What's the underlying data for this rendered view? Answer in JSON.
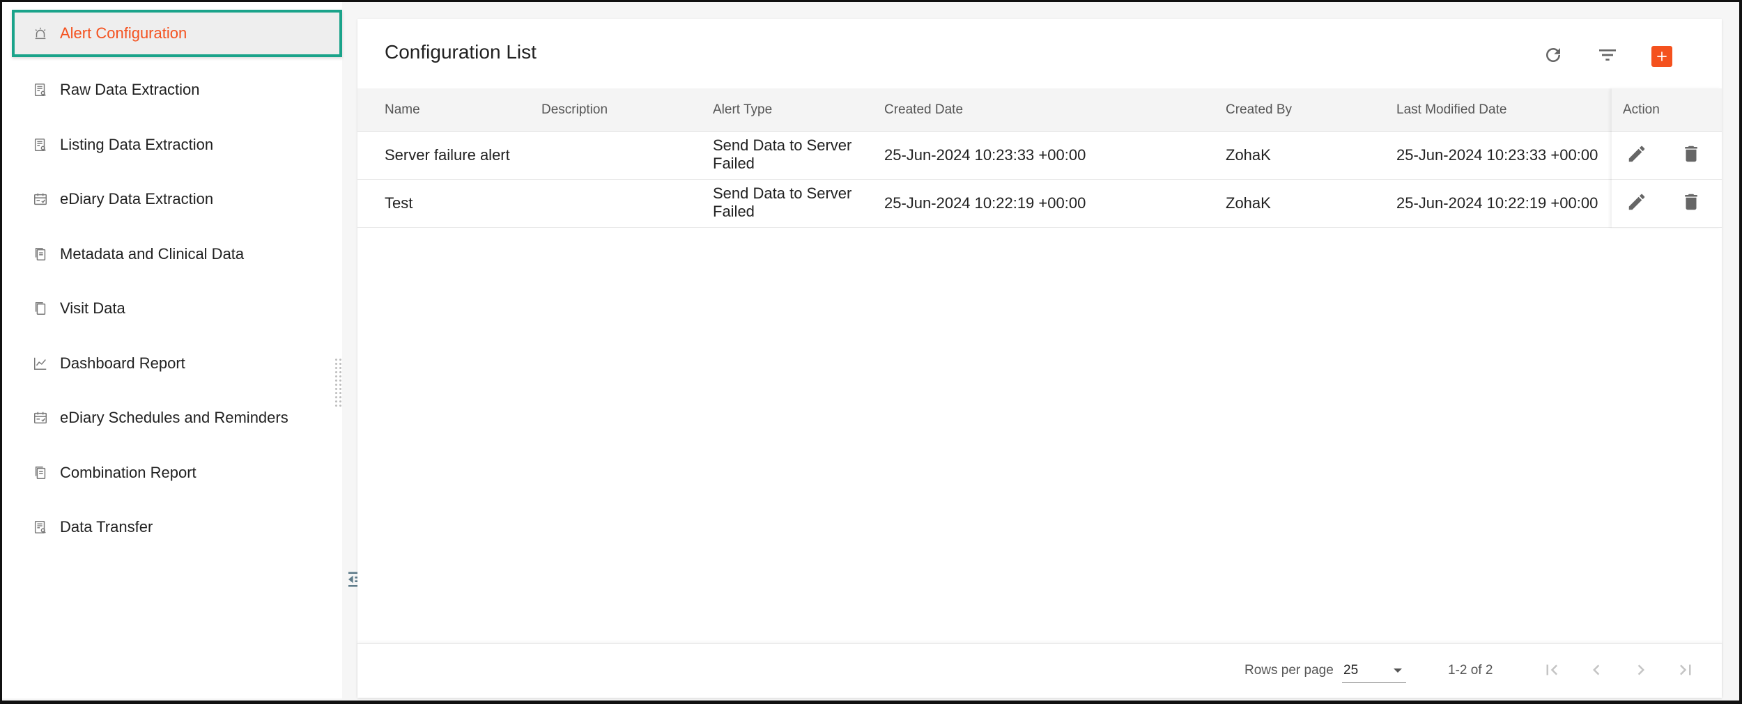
{
  "sidebar": {
    "items": [
      {
        "label": "Alert Configuration",
        "icon": "alarm-icon"
      },
      {
        "label": "Raw Data Extraction",
        "icon": "report-search-icon"
      },
      {
        "label": "Listing Data Extraction",
        "icon": "report-search-icon"
      },
      {
        "label": "eDiary Data Extraction",
        "icon": "calendar-check-icon"
      },
      {
        "label": "Metadata and Clinical Data",
        "icon": "copy-documents-icon"
      },
      {
        "label": "Visit Data",
        "icon": "copy-documents-icon"
      },
      {
        "label": "Dashboard Report",
        "icon": "line-chart-icon"
      },
      {
        "label": "eDiary Schedules and Reminders",
        "icon": "calendar-check-icon"
      },
      {
        "label": "Combination Report",
        "icon": "copy-documents-icon"
      },
      {
        "label": "Data Transfer",
        "icon": "report-search-icon"
      }
    ]
  },
  "main": {
    "title": "Configuration List",
    "toolbar_icons": [
      "refresh-icon",
      "filter-icon",
      "add-icon"
    ],
    "table": {
      "columns": [
        "Name",
        "Description",
        "Alert Type",
        "Created Date",
        "Created By",
        "Last Modified Date",
        "Action"
      ],
      "rows": [
        {
          "name": "Server failure alert",
          "description": "",
          "alert_type": "Send Data to Server Failed",
          "created_date": "25-Jun-2024 10:23:33 +00:00",
          "created_by": "ZohaK",
          "last_modified": "25-Jun-2024 10:23:33 +00:00"
        },
        {
          "name": "Test",
          "description": "",
          "alert_type": "Send Data to Server Failed",
          "created_date": "25-Jun-2024 10:22:19 +00:00",
          "created_by": "ZohaK",
          "last_modified": "25-Jun-2024 10:22:19 +00:00"
        }
      ]
    },
    "footer": {
      "rows_per_page_label": "Rows per page",
      "rows_per_page_value": "25",
      "range": "1-2 of 2"
    }
  },
  "colors": {
    "accent": "#f4511e",
    "highlight_border": "#1aa38a"
  }
}
